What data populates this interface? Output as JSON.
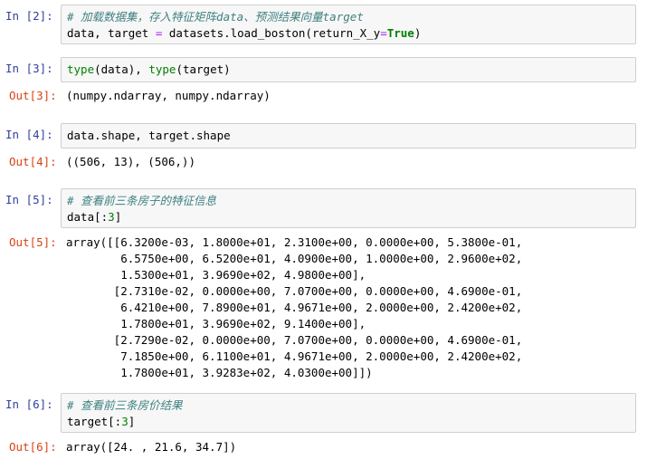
{
  "cells": [
    {
      "in_prompt": "In  [2]:",
      "code": {
        "comment": "# 加载数据集，存入特征矩阵data、预测结果向量target",
        "l2_a": "data, target ",
        "l2_eq": "=",
        "l2_b": " datasets.load_boston(return_X_y",
        "l2_eq2": "=",
        "l2_kw": "True",
        "l2_c": ")"
      }
    },
    {
      "in_prompt": "In  [3]:",
      "code": {
        "f1": "type",
        "a1": "(data), ",
        "f2": "type",
        "a2": "(target)"
      },
      "out_prompt": "Out[3]:",
      "output": [
        "(numpy.ndarray, numpy.ndarray)"
      ]
    },
    {
      "in_prompt": "In  [4]:",
      "code": {
        "line": "data.shape, target.shape"
      },
      "out_prompt": "Out[4]:",
      "output": [
        "((506, 13), (506,))"
      ]
    },
    {
      "in_prompt": "In  [5]:",
      "code": {
        "comment": "# 查看前三条房子的特征信息",
        "a": "data[:",
        "n": "3",
        "b": "]"
      },
      "out_prompt": "Out[5]:",
      "output": [
        "array([[6.3200e-03, 1.8000e+01, 2.3100e+00, 0.0000e+00, 5.3800e-01,",
        "        6.5750e+00, 6.5200e+01, 4.0900e+00, 1.0000e+00, 2.9600e+02,",
        "        1.5300e+01, 3.9690e+02, 4.9800e+00],",
        "       [2.7310e-02, 0.0000e+00, 7.0700e+00, 0.0000e+00, 4.6900e-01,",
        "        6.4210e+00, 7.8900e+01, 4.9671e+00, 2.0000e+00, 2.4200e+02,",
        "        1.7800e+01, 3.9690e+02, 9.1400e+00],",
        "       [2.7290e-02, 0.0000e+00, 7.0700e+00, 0.0000e+00, 4.6900e-01,",
        "        7.1850e+00, 6.1100e+01, 4.9671e+00, 2.0000e+00, 2.4200e+02,",
        "        1.7800e+01, 3.9283e+02, 4.0300e+00]])"
      ]
    },
    {
      "in_prompt": "In  [6]:",
      "code": {
        "comment": "# 查看前三条房价结果",
        "a": "target[:",
        "n": "3",
        "b": "]"
      },
      "out_prompt": "Out[6]:",
      "output": [
        "array([24. , 21.6, 34.7])"
      ]
    }
  ]
}
